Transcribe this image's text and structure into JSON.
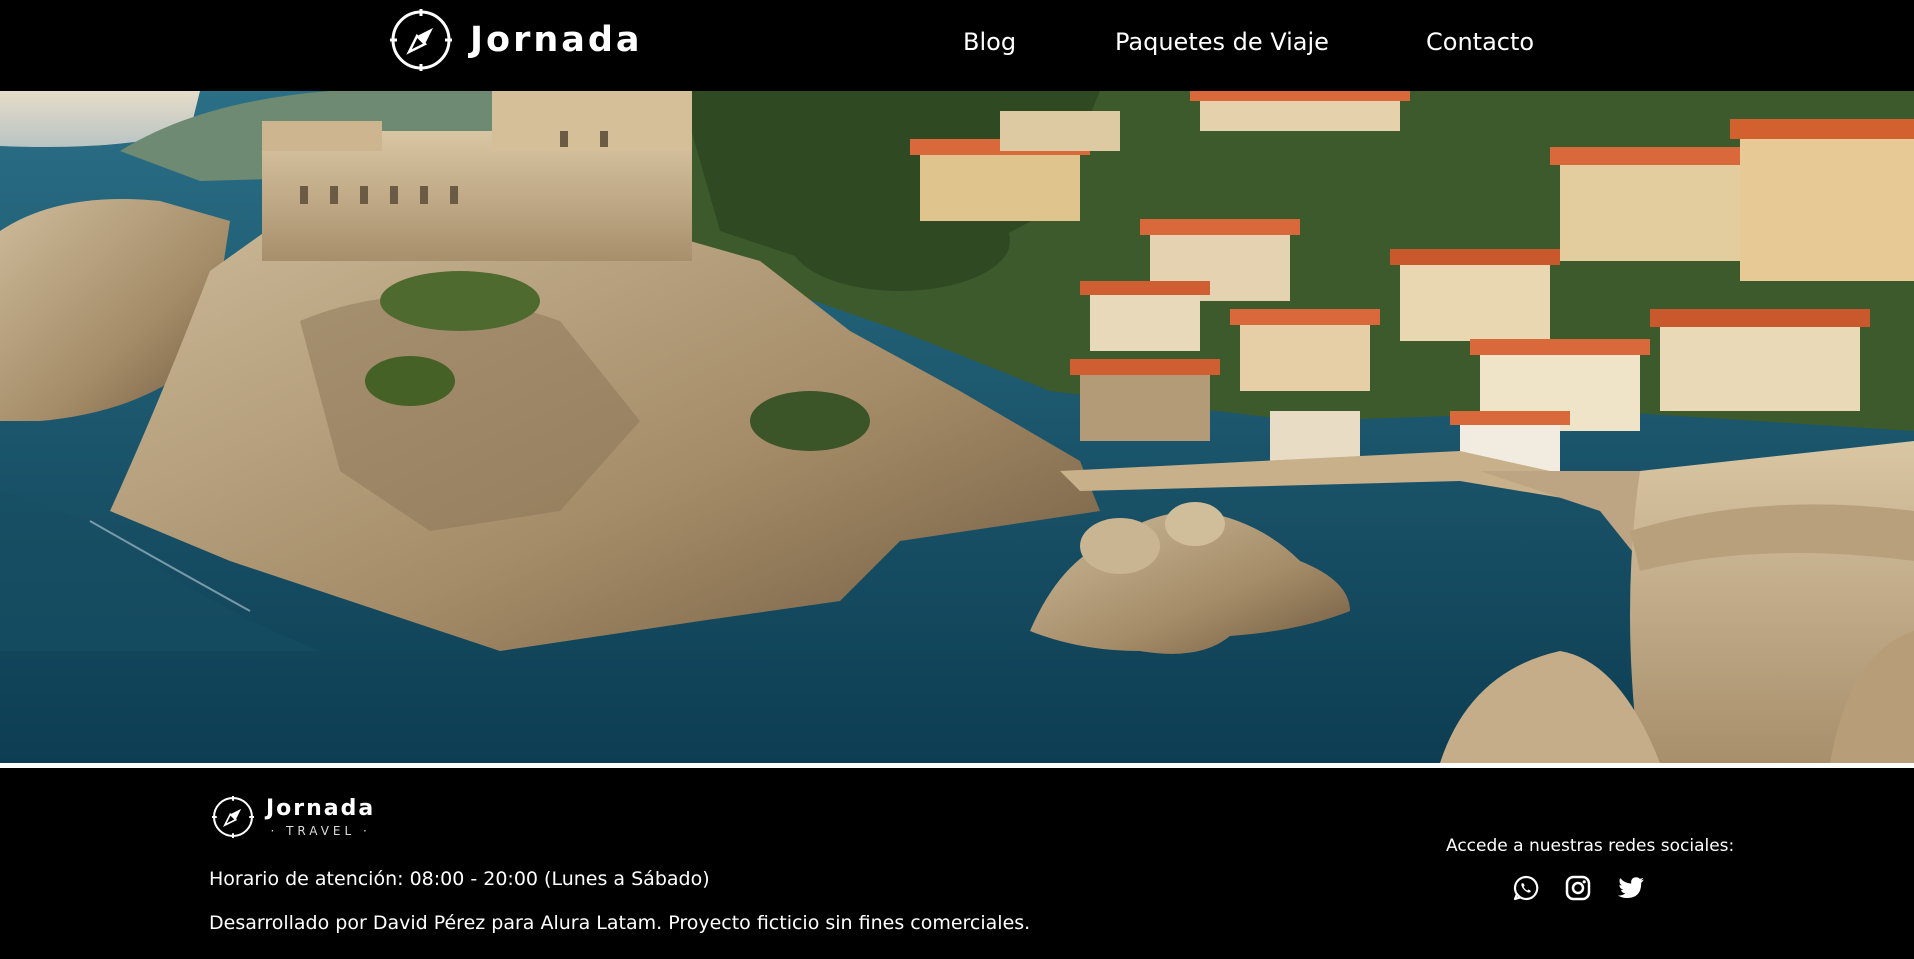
{
  "header": {
    "brand": "Jornada",
    "nav": [
      {
        "label": "Blog"
      },
      {
        "label": "Paquetes de Viaje"
      },
      {
        "label": "Contacto"
      }
    ]
  },
  "hero": {
    "icon": "coastal-town-photo"
  },
  "footer": {
    "brand_name": "Jornada",
    "brand_sub": "· TRAVEL ·",
    "hours": "Horario de atención: 08:00 - 20:00 (Lunes a Sábado)",
    "credits": "Desarrollado por David Pérez para Alura Latam. Proyecto ficticio sin fines comerciales.",
    "social_label": "Accede a nuestras redes sociales:",
    "social": [
      {
        "icon": "whatsapp-icon"
      },
      {
        "icon": "instagram-icon"
      },
      {
        "icon": "twitter-icon"
      }
    ]
  },
  "colors": {
    "background": "#000000",
    "text": "#ffffff",
    "sea": "#1c5f73",
    "roof": "#d9683a"
  }
}
